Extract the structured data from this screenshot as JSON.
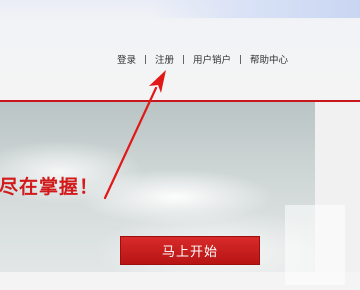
{
  "nav": {
    "login": "登录",
    "register": "注册",
    "cancel_account": "用户销户",
    "help_center": "帮助中心"
  },
  "banner": {
    "slogan": "尽在掌握！",
    "start_button": "马上开始"
  },
  "colors": {
    "brand_red": "#c8161d",
    "slogan_red": "#d21a1a",
    "button_red": "#c41e1e"
  }
}
